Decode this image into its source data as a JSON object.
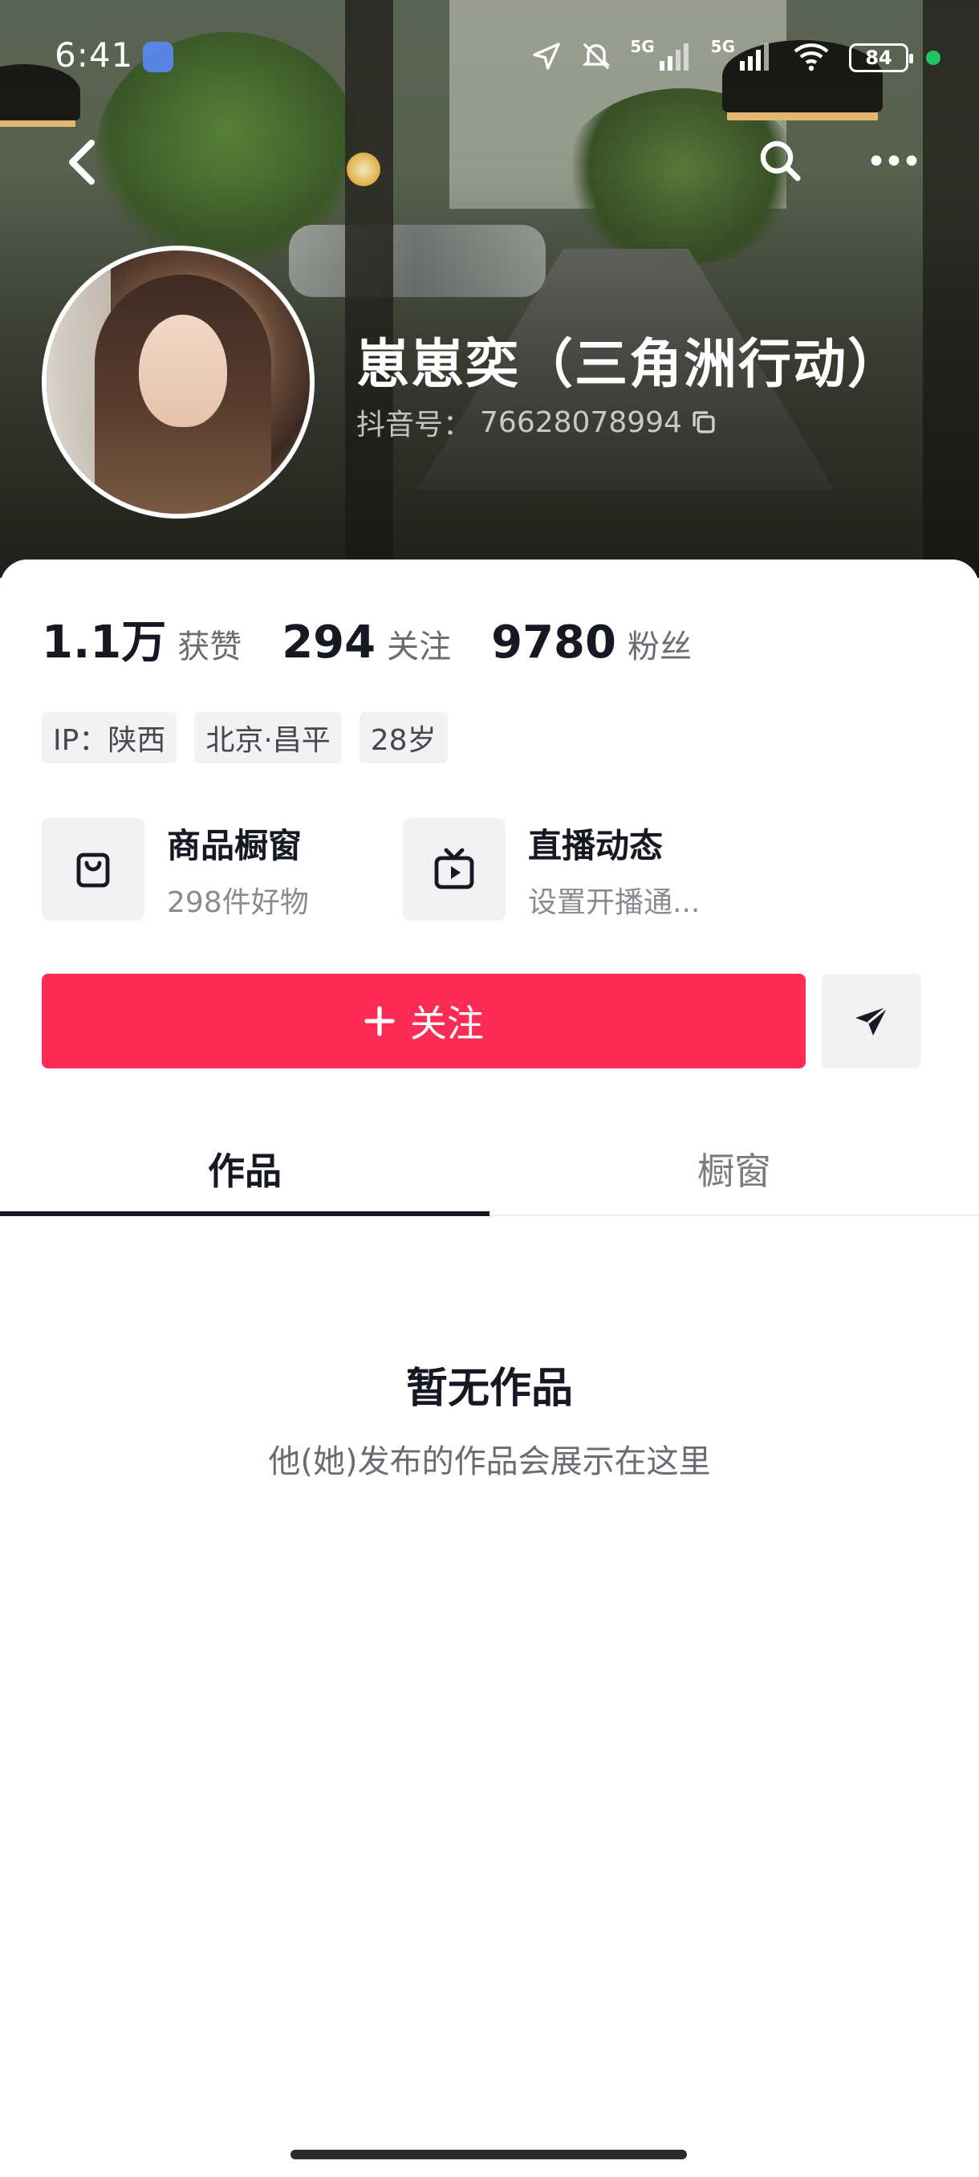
{
  "status_bar": {
    "time": "6:41",
    "network_1": "5G",
    "network_2": "5G",
    "battery": "84",
    "icons": [
      "app-icon",
      "location-icon",
      "mute-icon",
      "signal-icon",
      "signal-icon",
      "wifi-icon",
      "battery-icon",
      "green-dot"
    ]
  },
  "nav": {
    "back_icon": "back-chevron-icon",
    "search_icon": "search-icon",
    "more_icon": "more-icon"
  },
  "profile": {
    "name": "崽崽奕（三角洲行动）",
    "douyin_id_label": "抖音号：",
    "douyin_id": "76628078994",
    "copy_icon": "copy-icon"
  },
  "stats": [
    {
      "value": "1.1万",
      "label": "获赞"
    },
    {
      "value": "294",
      "label": "关注"
    },
    {
      "value": "9780",
      "label": "粉丝"
    }
  ],
  "tags": [
    "IP：陕西",
    "北京·昌平",
    "28岁"
  ],
  "entries": [
    {
      "title": "商品橱窗",
      "subtitle": "298件好物",
      "icon": "bag-icon"
    },
    {
      "title": "直播动态",
      "subtitle": "设置开播通...",
      "icon": "tv-icon"
    }
  ],
  "actions": {
    "follow_label": "关注",
    "follow_icon": "plus-icon",
    "share_icon": "send-icon",
    "accent": "#fe2c55"
  },
  "tabs": [
    {
      "label": "作品",
      "active": true
    },
    {
      "label": "橱窗",
      "active": false
    }
  ],
  "empty_state": {
    "title": "暂无作品",
    "subtitle": "他(她)发布的作品会展示在这里"
  }
}
